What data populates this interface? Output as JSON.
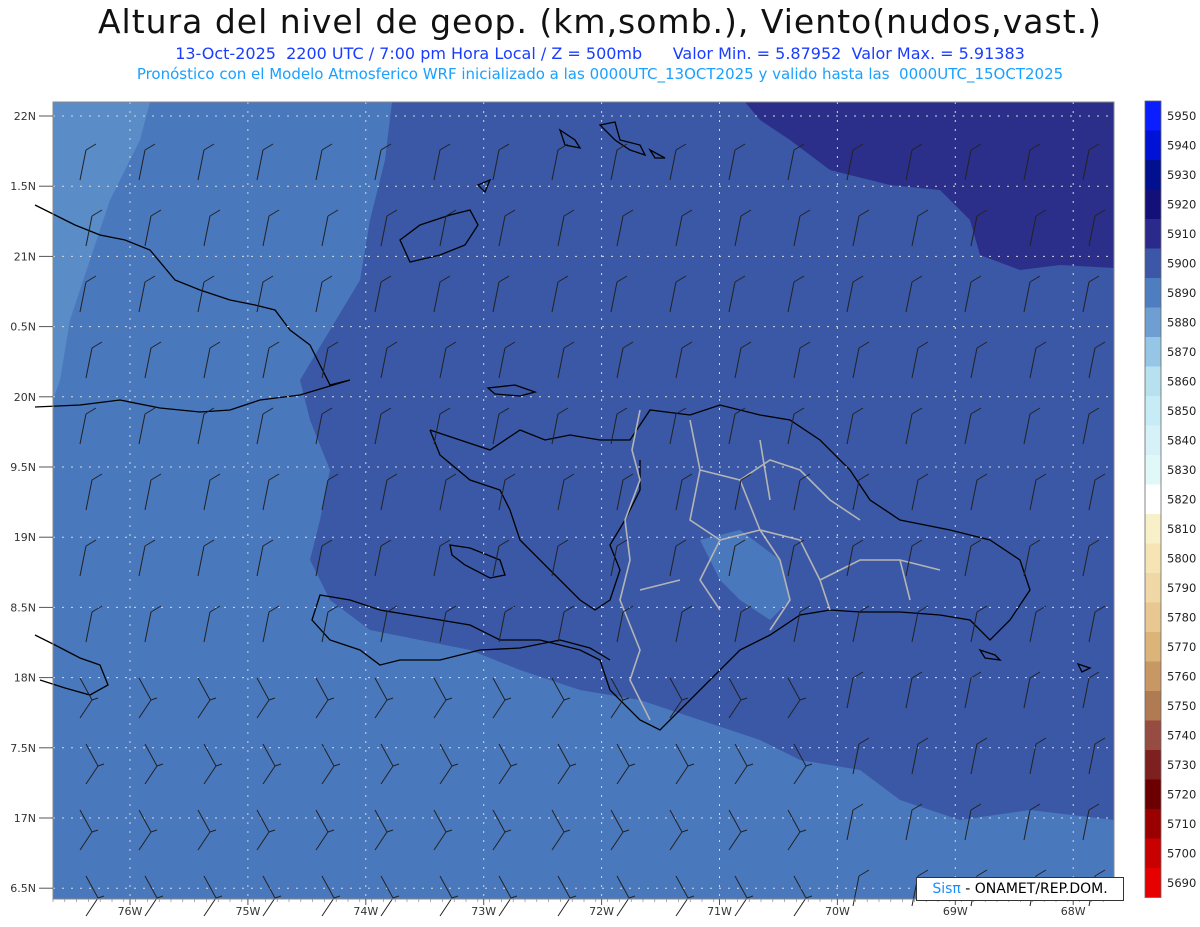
{
  "header": {
    "title": "Altura del nivel de geop. (km,somb.), Viento(nudos,vast.)",
    "subtitle_left": "13-Oct-2025  2200 UTC / 7:00 pm Hora Local / Z = 500mb",
    "subtitle_right": "Valor Min. = 5.87952  Valor Max. = 5.91383",
    "subtitle2": "Pronóstico con el Modelo Atmosferico WRF inicializado a las 0000UTC_13OCT2025 y valido hasta las  0000UTC_15OCT2025"
  },
  "axes": {
    "lat_labels": [
      "22N",
      "1.5N",
      "21N",
      "0.5N",
      "20N",
      "9.5N",
      "19N",
      "8.5N",
      "18N",
      "7.5N",
      "17N",
      "6.5N"
    ],
    "lon_labels": [
      "76W",
      "75W",
      "74W",
      "73W",
      "72W",
      "71W",
      "70W",
      "69W",
      "68W"
    ]
  },
  "colorbar": {
    "labels": [
      "5950",
      "5940",
      "5930",
      "5920",
      "5910",
      "5900",
      "5890",
      "5880",
      "5870",
      "5860",
      "5850",
      "5840",
      "5830",
      "5820",
      "5810",
      "5800",
      "5790",
      "5780",
      "5770",
      "5760",
      "5750",
      "5740",
      "5730",
      "5720",
      "5710",
      "5700",
      "5690"
    ],
    "colors": [
      "#0a1eff",
      "#0012d6",
      "#00108f",
      "#14107a",
      "#2a2a8c",
      "#3c56a8",
      "#4e7ec0",
      "#6f9ed3",
      "#96c6e6",
      "#b8e1f0",
      "#c8ecf6",
      "#d6f2f8",
      "#e0f8f8",
      "#ffffff",
      "#f8f0c8",
      "#f6e4b4",
      "#f0d8a6",
      "#e8c890",
      "#dcb47a",
      "#c89864",
      "#b07a52",
      "#964c40",
      "#7e2020",
      "#6c0000",
      "#9a0000",
      "#c80000",
      "#e60000"
    ]
  },
  "credit": {
    "sis": "Sisπ",
    "text": "- ONAMET/REP.DOM."
  },
  "colors": {
    "bg_main": "#4a78bd",
    "bg_dark": "#3a58a6",
    "bg_darkest": "#2c2f8a"
  }
}
